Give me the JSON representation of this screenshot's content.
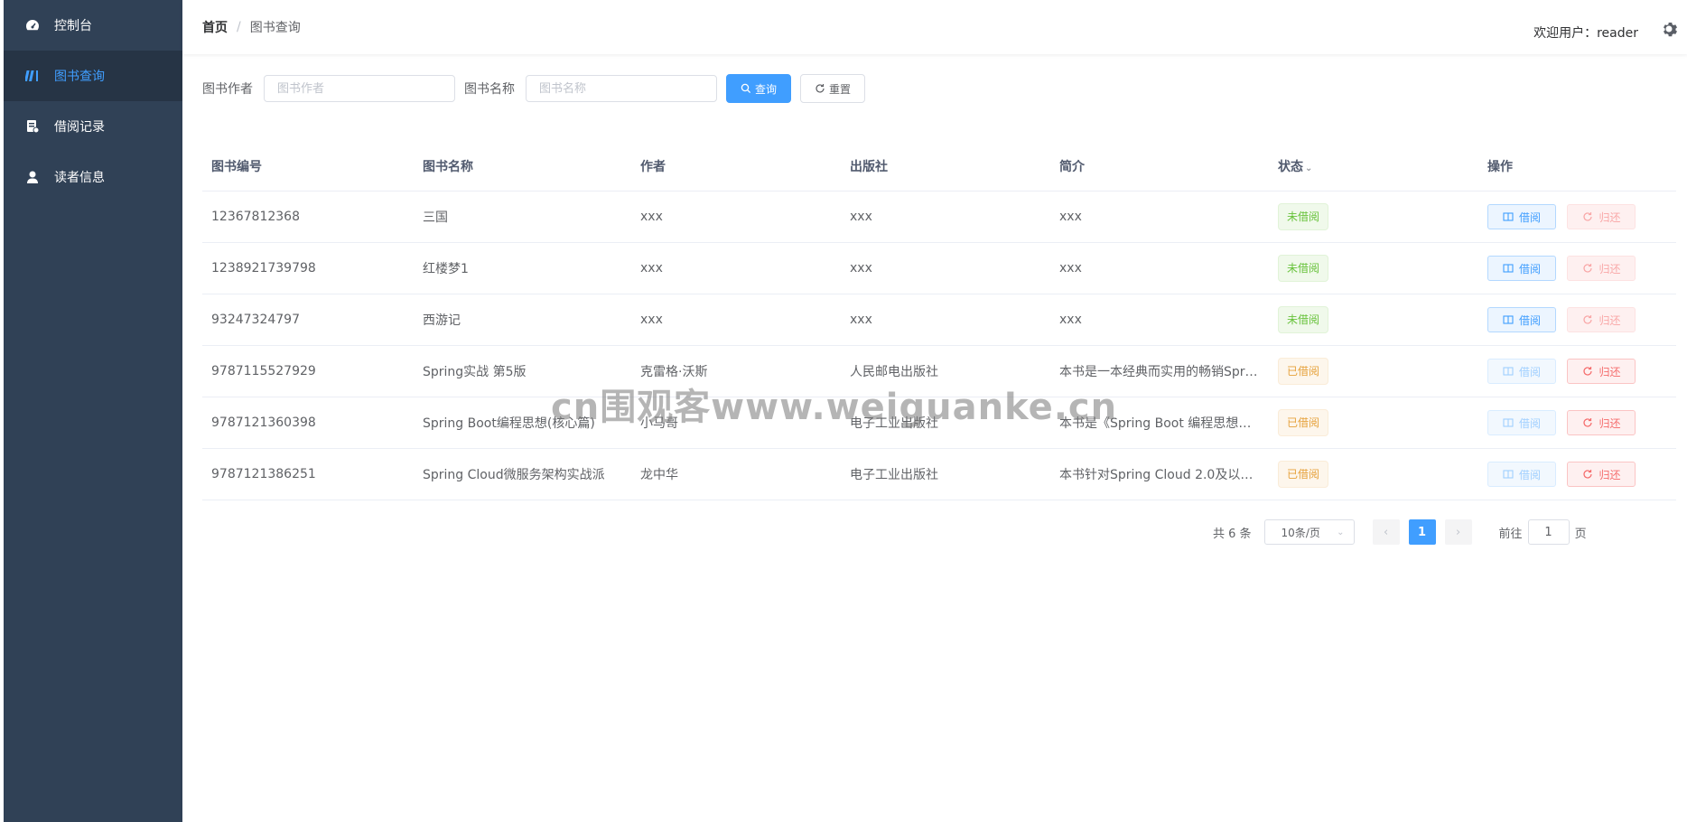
{
  "sidebar": {
    "items": [
      {
        "label": "控制台",
        "icon": "dashboard-icon"
      },
      {
        "label": "图书查询",
        "icon": "books-icon"
      },
      {
        "label": "借阅记录",
        "icon": "record-icon"
      },
      {
        "label": "读者信息",
        "icon": "user-icon"
      }
    ]
  },
  "header": {
    "breadcrumb_home": "首页",
    "breadcrumb_sep": "/",
    "breadcrumb_current": "图书查询",
    "welcome": "欢迎用户：reader"
  },
  "filter": {
    "author_label": "图书作者",
    "author_placeholder": "图书作者",
    "name_label": "图书名称",
    "name_placeholder": "图书名称",
    "search_label": "查询",
    "reset_label": "重置"
  },
  "table": {
    "columns": [
      "图书编号",
      "图书名称",
      "作者",
      "出版社",
      "简介",
      "状态",
      "操作"
    ],
    "rows": [
      {
        "id": "12367812368",
        "name": "三国",
        "author": "xxx",
        "publisher": "xxx",
        "intro": "xxx",
        "status": "未借阅"
      },
      {
        "id": "1238921739798",
        "name": "红楼梦1",
        "author": "xxx",
        "publisher": "xxx",
        "intro": "xxx",
        "status": "未借阅"
      },
      {
        "id": "93247324797",
        "name": "西游记",
        "author": "xxx",
        "publisher": "xxx",
        "intro": "xxx",
        "status": "未借阅"
      },
      {
        "id": "9787115527929",
        "name": "Spring实战 第5版",
        "author": "克雷格·沃斯",
        "publisher": "人民邮电出版社",
        "intro": "本书是一本经典而实用的畅销Spr…",
        "status": "已借阅"
      },
      {
        "id": "9787121360398",
        "name": "Spring Boot编程思想(核心篇)",
        "author": "小马哥",
        "publisher": "电子工业出版社",
        "intro": "本书是《Spring Boot 编程思想》…",
        "status": "已借阅"
      },
      {
        "id": "9787121386251",
        "name": "Spring Cloud微服务架构实战派",
        "author": "龙中华",
        "publisher": "电子工业出版社",
        "intro": "本书针对Spring Cloud 2.0及以上…",
        "status": "已借阅"
      }
    ],
    "borrow_label": "借阅",
    "return_label": "归还"
  },
  "pagination": {
    "total": "共 6 条",
    "page_size": "10条/页",
    "current_page": "1",
    "goto_label": "前往",
    "goto_value": "1",
    "page_unit": "页"
  },
  "watermark": "cn围观客www.weiguanke.cn",
  "colors": {
    "sidebar_bg": "#304156",
    "primary": "#409eff",
    "success": "#67c23a",
    "warning": "#e6a23c",
    "danger": "#f56c6c"
  }
}
